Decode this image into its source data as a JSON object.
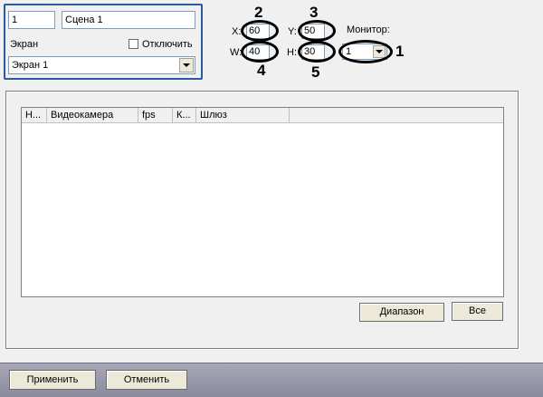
{
  "scene": {
    "id_value": "1",
    "name_value": "Сцена 1"
  },
  "screen": {
    "label": "Экран",
    "disable_label": "Отключить",
    "disable_checked": false,
    "selected": "Экран 1"
  },
  "position": {
    "x_label": "X:",
    "x_value": "60",
    "y_label": "Y:",
    "y_value": "50",
    "w_label": "W:",
    "w_value": "40",
    "h_label": "H:",
    "h_value": "30"
  },
  "monitor": {
    "label": "Монитор:",
    "selected": "1"
  },
  "callouts": {
    "c1": "1",
    "c2": "2",
    "c3": "3",
    "c4": "4",
    "c5": "5"
  },
  "table": {
    "columns": [
      "Н...",
      "Видеокамера",
      "fps",
      "К...",
      "Шлюз"
    ],
    "rows": []
  },
  "buttons": {
    "range": "Диапазон",
    "all": "Все",
    "apply": "Применить",
    "cancel": "Отменить"
  },
  "colors": {
    "group_border": "#2c5aa0",
    "bottom_bar": "#9a9aae"
  }
}
